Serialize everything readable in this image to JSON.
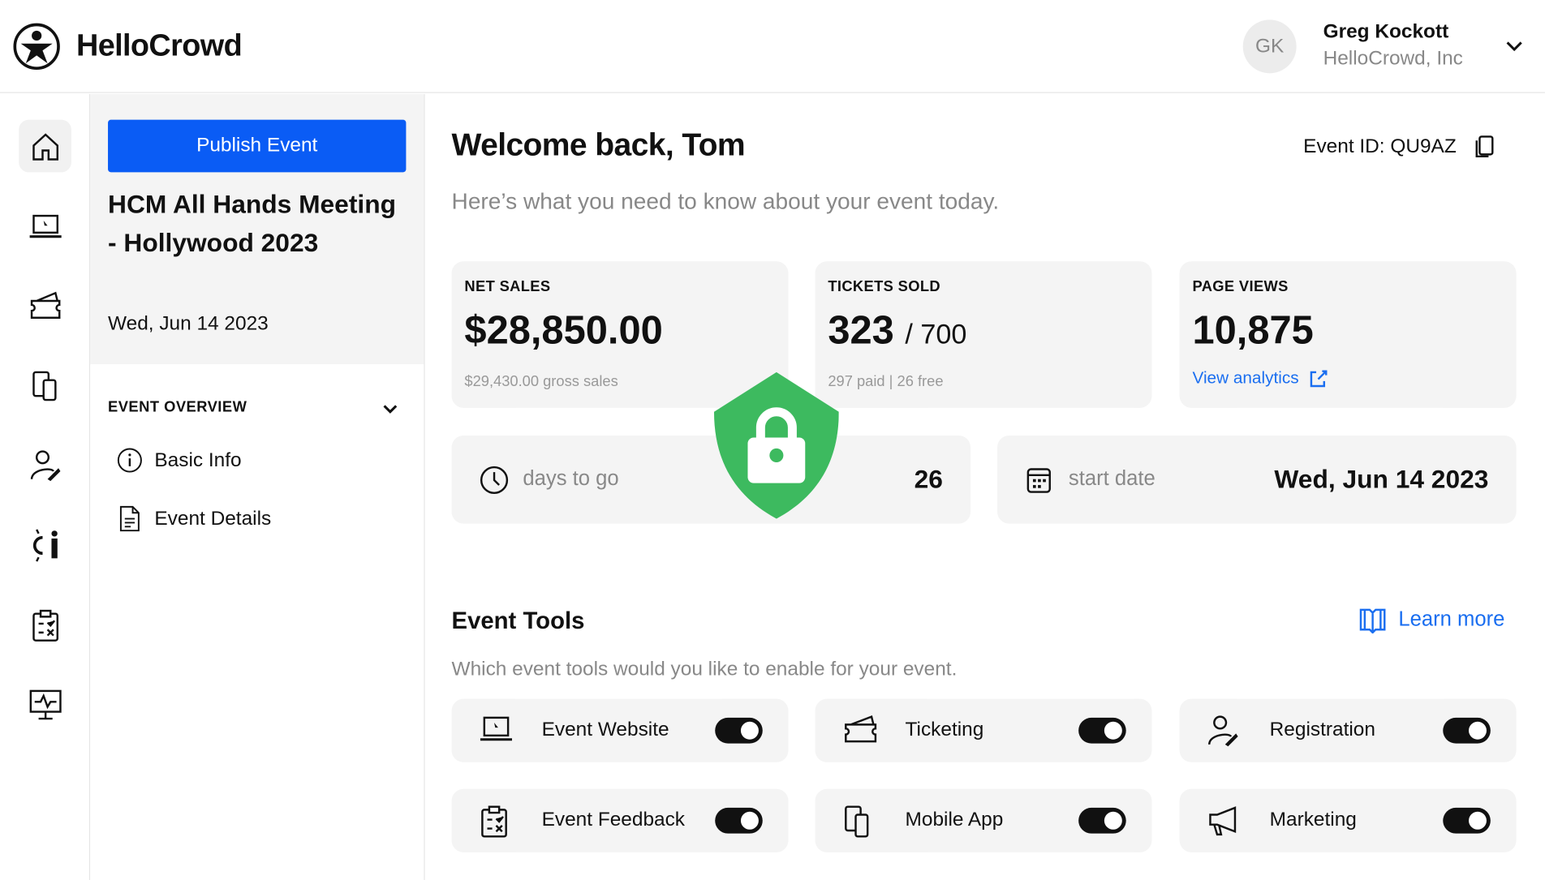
{
  "app": {
    "name": "HelloCrowd"
  },
  "user": {
    "initials": "GK",
    "name": "Greg Kockott",
    "org": "HelloCrowd, Inc"
  },
  "sidebar": {
    "publish_label": "Publish Event",
    "event_title": "HCM All Hands Meeting - Hollywood 2023",
    "event_date": "Wed, Jun 14 2023",
    "section": "EVENT OVERVIEW",
    "items": [
      {
        "label": "Basic Info",
        "icon": "info-icon"
      },
      {
        "label": "Event Details",
        "icon": "document-icon"
      }
    ]
  },
  "rail": [
    "home-icon",
    "laptop-icon",
    "ticket-icon",
    "mobile-icon",
    "registration-icon",
    "people-exchange-icon",
    "clipboard-icon",
    "monitor-pulse-icon"
  ],
  "main": {
    "title": "Welcome back, Tom",
    "subtitle": "Here’s what you need to know about your event today.",
    "event_id": "Event ID: QU9AZ",
    "stats": [
      {
        "label": "NET SALES",
        "value": "$28,850.00",
        "sub": "$29,430.00 gross sales"
      },
      {
        "label": "TICKETS SOLD",
        "value": "323",
        "value_suffix": "/ 700",
        "sub": "297 paid | 26 free"
      },
      {
        "label": "PAGE VIEWS",
        "value": "10,875",
        "link": "View analytics"
      }
    ],
    "days": {
      "label": "days to go",
      "value": "26"
    },
    "start": {
      "label": "start date",
      "value": "Wed, Jun 14 2023"
    },
    "tools_title": "Event Tools",
    "learn_more": "Learn more",
    "tools_sub": "Which event tools would you like to enable for your event.",
    "tools": [
      {
        "label": "Event Website",
        "enabled": true
      },
      {
        "label": "Ticketing",
        "enabled": true
      },
      {
        "label": "Registration",
        "enabled": true
      },
      {
        "label": "Event Feedback",
        "enabled": true
      },
      {
        "label": "Mobile App",
        "enabled": true
      },
      {
        "label": "Marketing",
        "enabled": true
      }
    ]
  },
  "colors": {
    "accent": "#0a5cf5",
    "lock": "#3dba5f",
    "link": "#1a6ef0"
  }
}
